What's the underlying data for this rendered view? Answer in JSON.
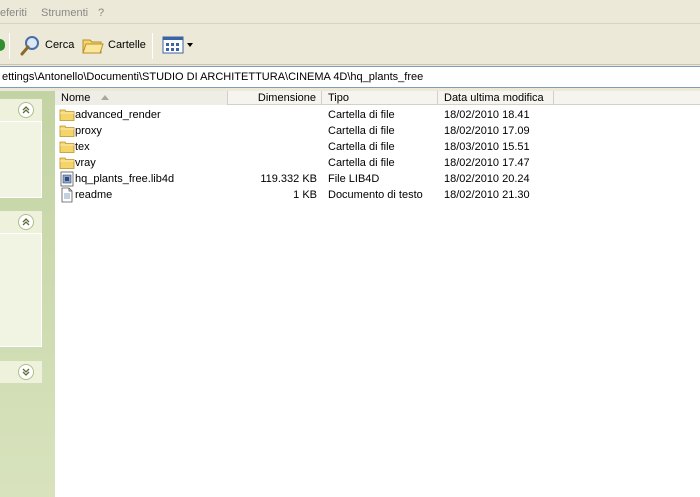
{
  "menu": {
    "items": [
      "eferiti",
      "Strumenti",
      "?"
    ]
  },
  "toolbar": {
    "search_label": "Cerca",
    "folders_label": "Cartelle"
  },
  "address": {
    "path": "ettings\\Antonello\\Documenti\\STUDIO DI ARCHITETTURA\\CINEMA 4D\\hq_plants_free"
  },
  "columns": {
    "name": "Nome",
    "size": "Dimensione",
    "type": "Tipo",
    "modified": "Data ultima modifica"
  },
  "files": [
    {
      "name": "advanced_render",
      "size": "",
      "type": "Cartella di file",
      "modified": "18/02/2010 18.41",
      "icon": "folder-icon"
    },
    {
      "name": "proxy",
      "size": "",
      "type": "Cartella di file",
      "modified": "18/02/2010 17.09",
      "icon": "folder-icon"
    },
    {
      "name": "tex",
      "size": "",
      "type": "Cartella di file",
      "modified": "18/03/2010 15.51",
      "icon": "folder-icon"
    },
    {
      "name": "vray",
      "size": "",
      "type": "Cartella di file",
      "modified": "18/02/2010 17.47",
      "icon": "folder-icon"
    },
    {
      "name": "hq_plants_free.lib4d",
      "size": "119.332 KB",
      "type": "File LIB4D",
      "modified": "18/02/2010 20.24",
      "icon": "lib4d-file-icon"
    },
    {
      "name": "readme",
      "size": "1 KB",
      "type": "Documento di testo",
      "modified": "18/02/2010 21.30",
      "icon": "text-document-icon"
    }
  ],
  "colors": {
    "accent": "#316ac5",
    "folder": "#f5d46a",
    "taskpane": "#c3d3a3"
  }
}
